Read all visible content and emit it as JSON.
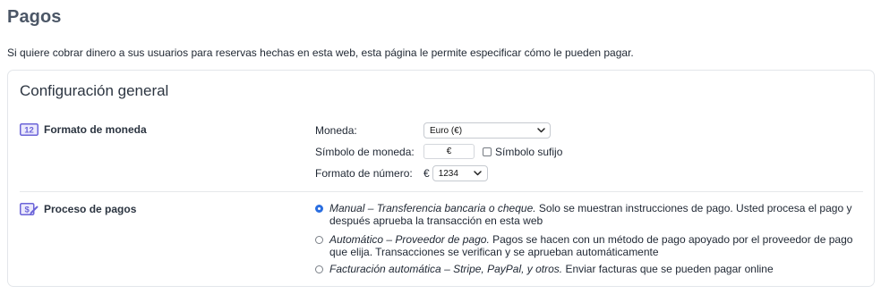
{
  "page": {
    "title": "Pagos",
    "description": "Si quiere cobrar dinero a sus usuarios para reservas hechas en esta web, esta página le permite especificar cómo le pueden pagar."
  },
  "card": {
    "title": "Configuración general"
  },
  "currency_format": {
    "section_label": "Formato de moneda",
    "icon": "currency-format-icon",
    "icon_text": "12",
    "moneda_label": "Moneda:",
    "moneda_value": "Euro (€)",
    "simbolo_label": "Símbolo de moneda:",
    "simbolo_value": "€",
    "sufijo_label": "Símbolo sufijo",
    "sufijo_checked": false,
    "formato_label": "Formato de número:",
    "formato_prefix": "€",
    "formato_value": "1234"
  },
  "payment_process": {
    "section_label": "Proceso de pagos",
    "icon": "payment-process-icon",
    "icon_text": "$",
    "options": [
      {
        "title": "Manual – Transferencia bancaria o cheque.",
        "description": " Solo se muestran instrucciones de pago. Usted procesa el pago y después aprueba la transacción en esta web",
        "selected": true
      },
      {
        "title": "Automático – Proveedor de pago.",
        "description": " Pagos se hacen con un método de pago apoyado por el proveedor de pago que elija. Transacciones se verifican y se aprueban automáticamente",
        "selected": false
      },
      {
        "title": "Facturación automática – Stripe, PayPal, y otros.",
        "description": " Enviar facturas que se pueden pagar online",
        "selected": false
      }
    ]
  },
  "colors": {
    "accent": "#2a6ee0",
    "icon_purple": "#6b64d8",
    "heading": "#4b5666"
  }
}
